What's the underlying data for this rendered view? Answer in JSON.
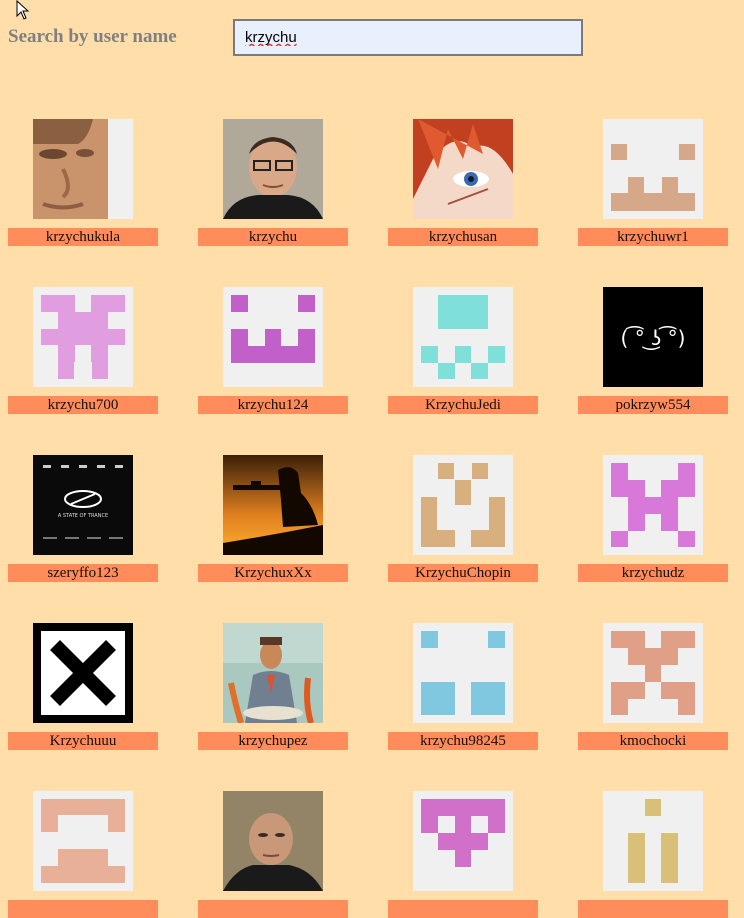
{
  "search": {
    "label": "Search by user name",
    "value": "krzychu"
  },
  "users": [
    {
      "name": "krzychukula",
      "avatar": "photo-man-closeup-icon"
    },
    {
      "name": "krzychu",
      "avatar": "photo-man-glasses-icon"
    },
    {
      "name": "krzychusan",
      "avatar": "anime-red-hair-icon"
    },
    {
      "name": "krzychuwr1",
      "avatar": "identicon-icon",
      "color": "#d4a888"
    },
    {
      "name": "krzychu700",
      "avatar": "identicon-icon",
      "color": "#e09ee0"
    },
    {
      "name": "krzychu124",
      "avatar": "identicon-icon",
      "color": "#c060c8"
    },
    {
      "name": "KrzychuJedi",
      "avatar": "identicon-icon",
      "color": "#7ee0d8"
    },
    {
      "name": "pokrzyw554",
      "avatar": "lenny-face-icon",
      "text": "( ͡° ͜ʖ ͡°)"
    },
    {
      "name": "szeryffo123",
      "avatar": "a-state-of-trance-album-icon",
      "text": "A STATE OF TRANCE"
    },
    {
      "name": "KrzychuxXx",
      "avatar": "soldier-silhouette-sunset-icon"
    },
    {
      "name": "KrzychuChopin",
      "avatar": "identicon-icon",
      "color": "#d8b080"
    },
    {
      "name": "krzychudz",
      "avatar": "identicon-icon",
      "color": "#d878d8"
    },
    {
      "name": "Krzychuuu",
      "avatar": "x-mark-icon"
    },
    {
      "name": "krzychupez",
      "avatar": "painting-man-icon"
    },
    {
      "name": "krzychu98245",
      "avatar": "identicon-icon",
      "color": "#80c8e0"
    },
    {
      "name": "kmochocki",
      "avatar": "identicon-icon",
      "color": "#e0a088"
    },
    {
      "name": "",
      "avatar": "identicon-icon",
      "color": "#e8b098"
    },
    {
      "name": "",
      "avatar": "photo-man-bald-icon"
    },
    {
      "name": "",
      "avatar": "identicon-icon",
      "color": "#d070c8"
    },
    {
      "name": "",
      "avatar": "identicon-icon",
      "color": "#d8c078"
    }
  ]
}
